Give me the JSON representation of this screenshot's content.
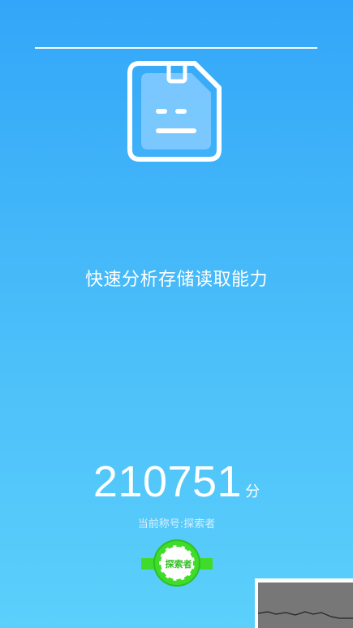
{
  "headline": "快速分析存储读取能力",
  "score": {
    "value": "210751",
    "unit": "分"
  },
  "current_title": {
    "label": "当前称号:",
    "value": "探索者"
  },
  "badge": {
    "text": "探索者",
    "color": "#3fdc2a"
  },
  "icons": {
    "main": "sd-card-icon"
  },
  "colors": {
    "background_top": "#33a6f9",
    "background_bottom": "#5bd0fb",
    "text": "#ffffff",
    "badge": "#3fdc2a"
  }
}
